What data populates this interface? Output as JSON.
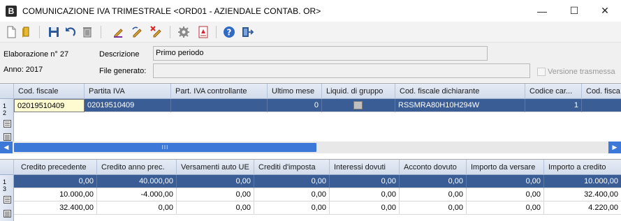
{
  "window": {
    "app_icon_letter": "B",
    "title": "COMUNICAZIONE IVA TRIMESTRALE <ORD01 - AZIENDALE CONTAB. OR>",
    "minimize_glyph": "—",
    "maximize_glyph": "☐",
    "close_glyph": "✕"
  },
  "toolbar": {
    "icons": [
      "new-document-icon",
      "open-folder-icon",
      "save-icon",
      "undo-icon",
      "delete-icon",
      "edit-pen-icon",
      "edit-back-icon",
      "edit-cancel-icon",
      "settings-gear-icon",
      "pdf-report-icon",
      "help-icon",
      "exit-door-icon"
    ]
  },
  "form": {
    "elaborazione_label": "Elaborazione n° 27",
    "anno_label": "Anno: 2017",
    "descrizione_label": "Descrizione",
    "descrizione_value": "Primo periodo",
    "file_label": "File generato:",
    "file_value": "",
    "versione_label": "Versione trasmessa",
    "versione_checked": false
  },
  "grid1": {
    "columns": [
      "Cod. fiscale",
      "Partita IVA",
      "Part. IVA controllante",
      "Ultimo mese",
      "Liquid. di gruppo",
      "Cod. fiscale dichiarante",
      "Codice car...",
      "Cod. fisca"
    ],
    "row_numbers": [
      "1",
      "2"
    ],
    "rows": [
      [
        "02019510409",
        "02019510409",
        "",
        "0",
        "",
        "RSSMRA80H10H294W",
        "1",
        ""
      ]
    ],
    "scroll_thumb_grip": "III"
  },
  "grid2": {
    "columns": [
      "Credito precedente",
      "Credito anno prec.",
      "Versamenti auto UE",
      "Crediti d'imposta",
      "Interessi dovuti",
      "Acconto dovuto",
      "Importo da versare",
      "Importo a credito"
    ],
    "row_numbers": [
      "1",
      "3"
    ],
    "rows": [
      [
        "0,00",
        "40.000,00",
        "0,00",
        "0,00",
        "0,00",
        "0,00",
        "0,00",
        "10.000,00"
      ],
      [
        "10.000,00",
        "-4.000,00",
        "0,00",
        "0,00",
        "0,00",
        "0,00",
        "0,00",
        "32.400,00"
      ],
      [
        "32.400,00",
        "0,00",
        "0,00",
        "0,00",
        "0,00",
        "0,00",
        "0,00",
        "4.220,00"
      ]
    ]
  },
  "colors": {
    "selected_row": "#3a5d96",
    "active_cell": "#fefbd0",
    "scrollbar": "#3c78d8"
  }
}
